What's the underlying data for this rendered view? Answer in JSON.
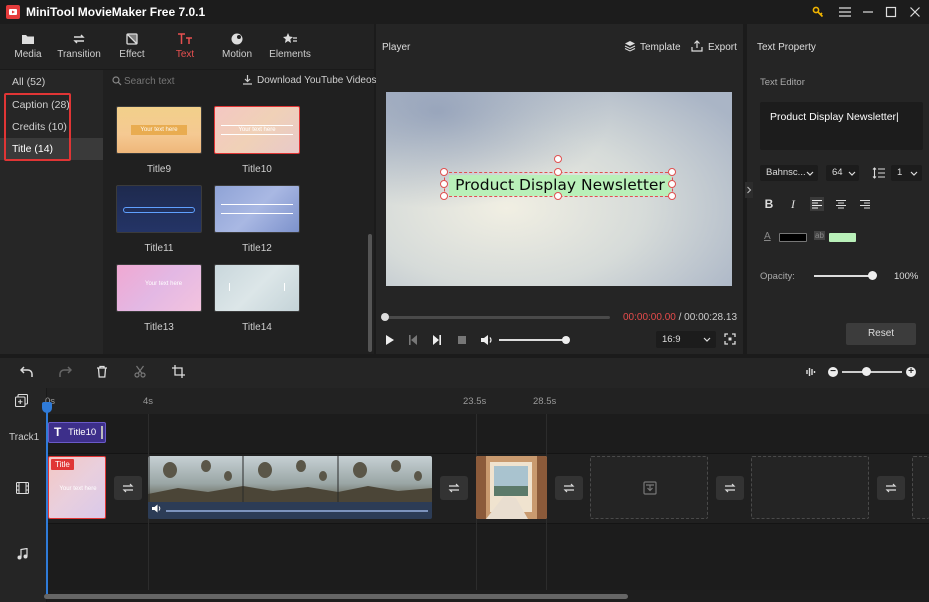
{
  "app": {
    "title": "MiniTool MovieMaker Free 7.0.1"
  },
  "tabs": [
    {
      "label": "Media",
      "icon": "folder-icon"
    },
    {
      "label": "Transition",
      "icon": "swap-icon"
    },
    {
      "label": "Effect",
      "icon": "effect-icon"
    },
    {
      "label": "Text",
      "icon": "text-icon",
      "active": true
    },
    {
      "label": "Motion",
      "icon": "motion-icon"
    },
    {
      "label": "Elements",
      "icon": "elements-icon"
    }
  ],
  "categories": [
    {
      "label": "All (52)"
    },
    {
      "label": "Caption (28)"
    },
    {
      "label": "Credits (10)"
    },
    {
      "label": "Title (14)",
      "active": true
    }
  ],
  "search": {
    "placeholder": "Search text",
    "download_label": "Download YouTube Videos"
  },
  "templates": [
    {
      "label": "Title9",
      "thumb_text": "Your text here",
      "selected": false
    },
    {
      "label": "Title10",
      "thumb_text": "Your text here",
      "selected": true
    },
    {
      "label": "Title11",
      "thumb_text": "",
      "selected": false
    },
    {
      "label": "Title12",
      "thumb_text": "",
      "selected": false
    },
    {
      "label": "Title13",
      "thumb_text": "Your text here",
      "selected": false
    },
    {
      "label": "Title14",
      "thumb_text": "",
      "selected": false
    }
  ],
  "player": {
    "title": "Player",
    "template_label": "Template",
    "export_label": "Export",
    "canvas_text": "Product Display Newsletter",
    "time_current": "00:00:00.00",
    "time_separator": "/",
    "time_total": "00:00:28.13",
    "aspect": "16:9"
  },
  "property": {
    "title": "Text Property",
    "editor_label": "Text Editor",
    "editor_value": "Product Display Newsletter",
    "font": "Bahnsc...",
    "size": "64",
    "line_spacing": "1",
    "opacity_label": "Opacity:",
    "opacity_value": "100%",
    "reset_label": "Reset",
    "text_color": "#000000",
    "bg_color": "#b9f0b9"
  },
  "timeline": {
    "ruler": [
      "0s",
      "4s",
      "23.5s",
      "28.5s"
    ],
    "track_label": "Track1",
    "title_clip": "Title10",
    "clip_badge": "Title",
    "clip_thumb_text": "Your text here"
  },
  "colors": {
    "accent": "#e53c3c",
    "playhead": "#2f7bd8",
    "text_highlight": "#b9f0b9"
  }
}
